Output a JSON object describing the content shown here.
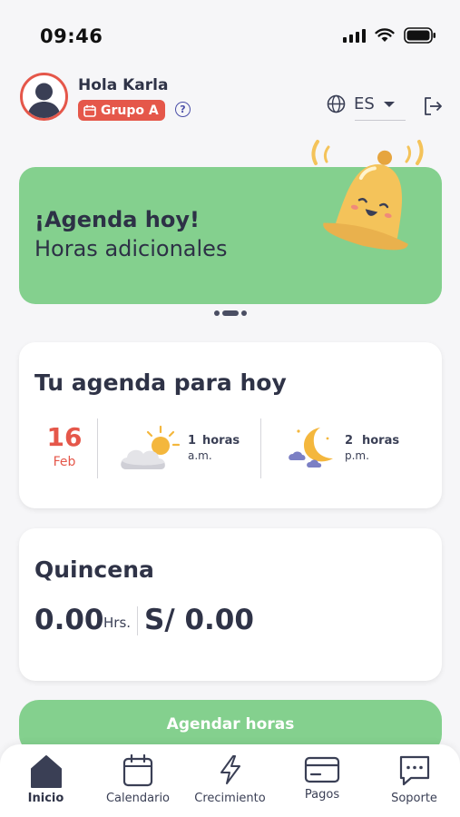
{
  "status_bar": {
    "time": "09:46"
  },
  "header": {
    "greeting": "Hola Karla",
    "group_label": "Grupo A",
    "help_symbol": "?",
    "language": "ES"
  },
  "banner": {
    "title": "¡Agenda hoy!",
    "subtitle": "Horas adicionales",
    "carousel_index": 1,
    "carousel_count": 3
  },
  "agenda": {
    "title": "Tu agenda para hoy",
    "date_day": "16",
    "date_month": "Feb",
    "morning": {
      "count": "1",
      "unit": "horas",
      "period": "a.m."
    },
    "night": {
      "count": "2",
      "unit": "horas",
      "period": "p.m."
    }
  },
  "quincena": {
    "title": "Quincena",
    "hours": "0.00",
    "hours_unit": "Hrs.",
    "amount": "S/ 0.00"
  },
  "cta": {
    "label": "Agendar horas"
  },
  "nav": {
    "items": [
      {
        "label": "Inicio",
        "icon": "home-icon",
        "active": true
      },
      {
        "label": "Calendario",
        "icon": "calendar-icon",
        "active": false
      },
      {
        "label": "Crecimiento",
        "icon": "lightning-icon",
        "active": false
      },
      {
        "label": "Pagos",
        "icon": "card-icon",
        "active": false
      },
      {
        "label": "Soporte",
        "icon": "chat-icon",
        "active": false
      }
    ]
  },
  "colors": {
    "accent_red": "#e5574a",
    "green": "#84d08e",
    "text_dark": "#2f3347",
    "bell_yellow": "#f4c35a"
  }
}
